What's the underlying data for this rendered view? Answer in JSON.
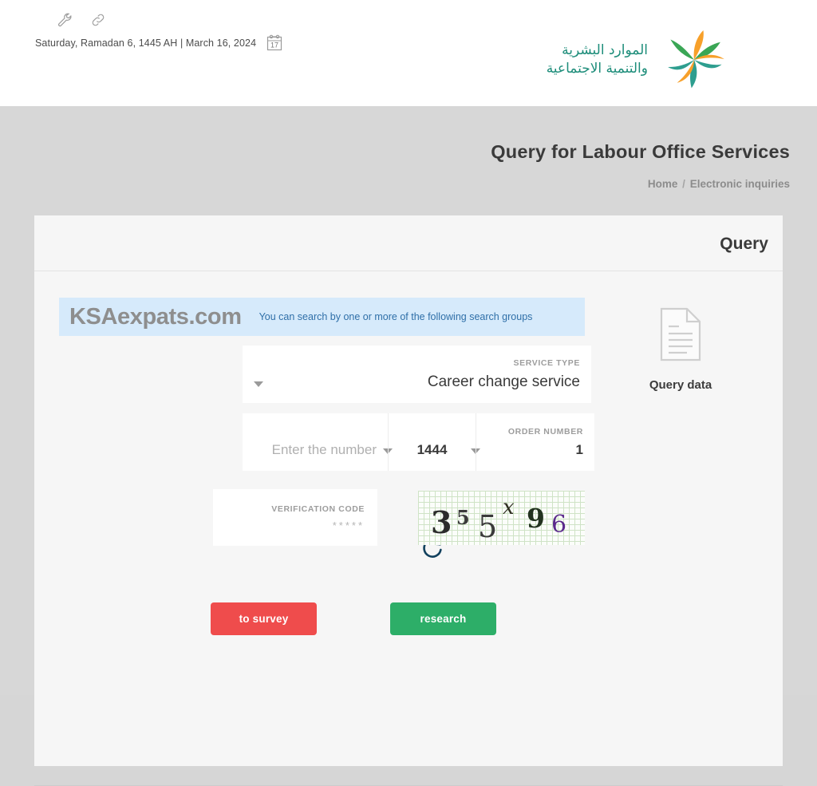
{
  "topbar": {
    "icons": [
      {
        "name": "wrench-icon",
        "label": "wrench"
      },
      {
        "name": "link-icon",
        "label": "link"
      }
    ],
    "date_text": "Saturday, Ramadan 6, 1445 AH | March 16, 2024",
    "calendar_icon_day": "17",
    "logo": {
      "text_line1": "الموارد البشرية",
      "text_line2": "والتنمية الاجتماعية",
      "color_green": "#1d8d7a",
      "color_orange": "#f7a02a",
      "color_leaf": "#3aa655"
    }
  },
  "page": {
    "title": "Query for Labour Office Services",
    "breadcrumb_home": "Home",
    "breadcrumb_sep": "/",
    "breadcrumb_current": "Electronic inquiries"
  },
  "card": {
    "header_title": "Query",
    "banner": {
      "watermark": "KSAexpats.com",
      "message": "You can search by one or more of the following search groups",
      "background": "#d6eafb",
      "text_color": "#2f6fa8"
    },
    "doc_widget": {
      "icon": "document-icon",
      "label": "Query data"
    },
    "form": {
      "service_type": {
        "label": "SERVICE TYPE",
        "value": "Career change service"
      },
      "order_number": {
        "label": "ORDER NUMBER",
        "value": "1",
        "year_value": "1444",
        "number_placeholder": "Enter the number"
      },
      "verification": {
        "label": "VERIFICATION CODE",
        "value": "*****",
        "refresh_icon": "refresh-icon",
        "captcha_characters": [
          "3",
          "5",
          "5",
          "x",
          "9",
          "6"
        ],
        "captcha_text": "355x96"
      }
    },
    "buttons": {
      "survey": "to survey",
      "research": "research",
      "survey_color": "#ef4c4c",
      "research_color": "#2dae68"
    }
  }
}
